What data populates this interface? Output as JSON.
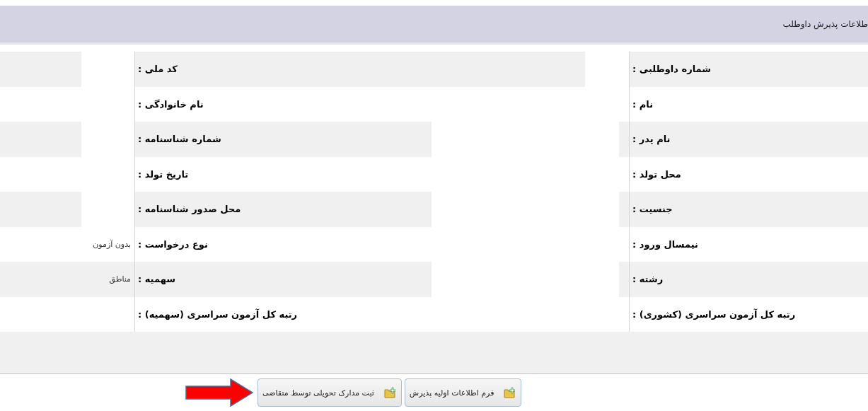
{
  "header": {
    "title": "طلاعات پذیرش داوطلب"
  },
  "rows": [
    {
      "right": {
        "label": "شماره داوطلبی :",
        "redacted": true,
        "narrow": true
      },
      "left": {
        "label": "کد ملی :",
        "redacted": true
      }
    },
    {
      "right": {
        "label": "نام :"
      },
      "left": {
        "label": "نام خانوادگی :",
        "redacted": true
      }
    },
    {
      "right": {
        "label": "نام پدر :",
        "redacted": true
      },
      "left": {
        "label": "شماره شناسنامه :",
        "redacted": true
      }
    },
    {
      "right": {
        "label": "محل تولد :",
        "redacted": true
      },
      "left": {
        "label": "تاریخ تولد :",
        "redacted": true
      }
    },
    {
      "right": {
        "label": "جنسیت :",
        "redacted": true
      },
      "left": {
        "label": "محل صدور شناسنامه :",
        "redacted": true
      }
    },
    {
      "right": {
        "label": "نیمسال ورود :",
        "redacted": true
      },
      "left": {
        "label": "نوع درخواست :",
        "value": "بدون آزمون"
      }
    },
    {
      "right": {
        "label": "رشته :",
        "redacted": true
      },
      "left": {
        "label": "سهمیه :",
        "value": "مناطق"
      }
    },
    {
      "right": {
        "label": "رتبه کل آزمون سراسری (کشوری) :"
      },
      "left": {
        "label": "رتبه کل آزمون سراسری (سهمیه) :"
      }
    }
  ],
  "buttons": [
    {
      "label": "فرم اطلاعات اولیه پذیرش"
    },
    {
      "label": "ثبت مدارک تحویلی توسط متقاضی"
    }
  ]
}
